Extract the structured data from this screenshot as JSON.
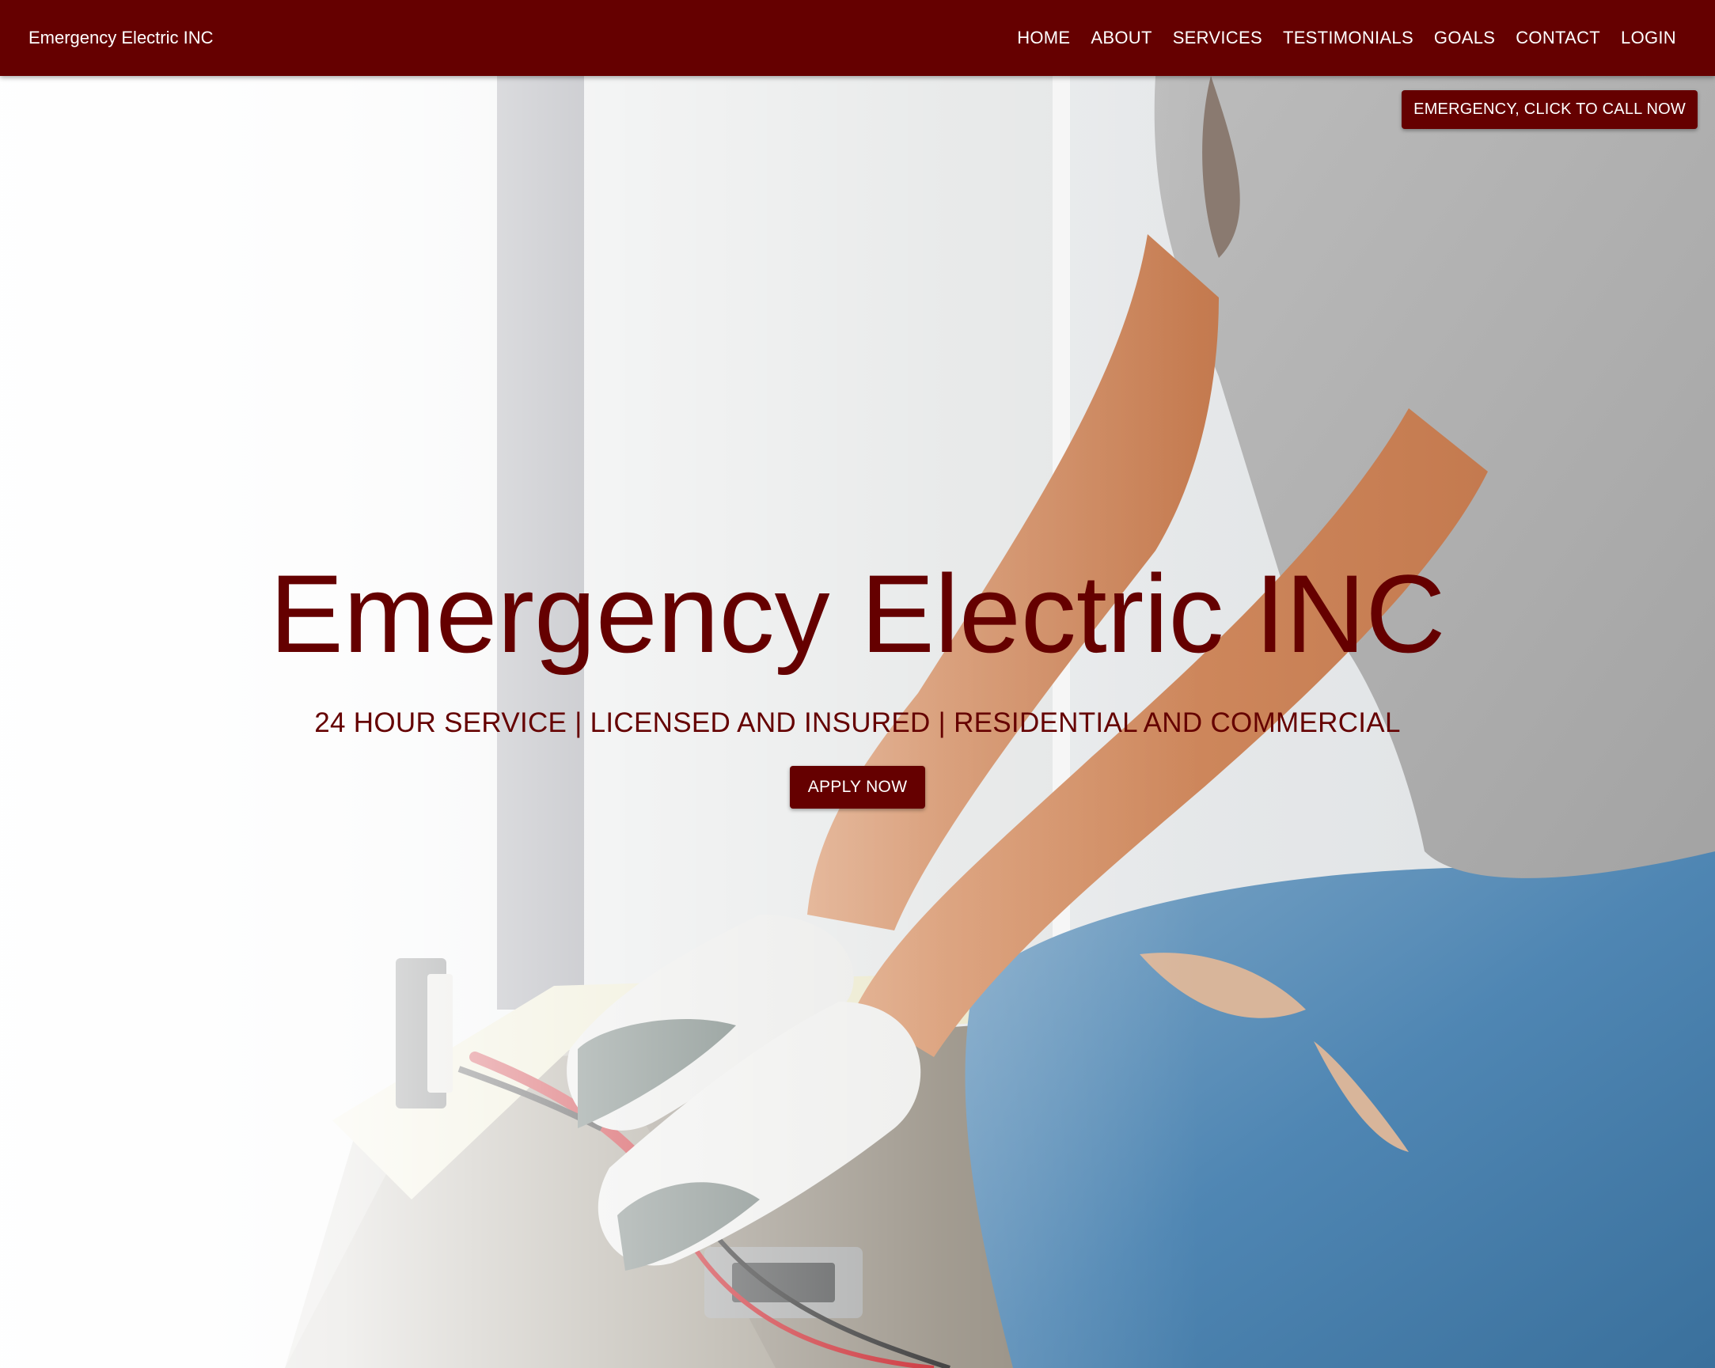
{
  "navbar": {
    "brand": "Emergency Electric INC",
    "links": [
      {
        "label": "HOME"
      },
      {
        "label": "ABOUT"
      },
      {
        "label": "SERVICES"
      },
      {
        "label": "TESTIMONIALS"
      },
      {
        "label": "GOALS"
      },
      {
        "label": "CONTACT"
      },
      {
        "label": "LOGIN"
      }
    ]
  },
  "hero": {
    "emergency_button": "EMERGENCY, CLICK TO CALL NOW",
    "title": "Emergency Electric INC",
    "subtitle": "24 HOUR SERVICE | LICENSED AND INSURED | RESIDENTIAL AND COMMERCIAL",
    "cta_button": "APPLY NOW",
    "background_image": "electrician-testing-wall-outlet-photo"
  },
  "colors": {
    "brand": "#650000",
    "text_on_brand": "#ffffff"
  }
}
